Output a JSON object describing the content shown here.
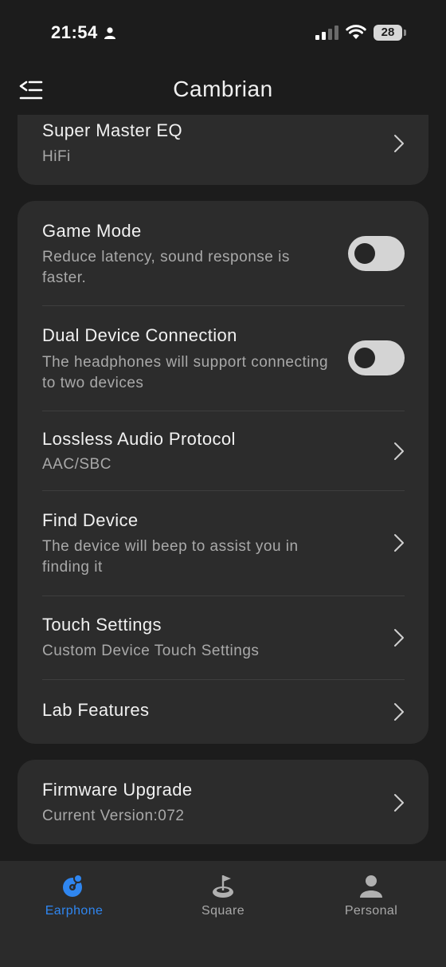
{
  "status_bar": {
    "time": "21:54",
    "battery": "28"
  },
  "header": {
    "title": "Cambrian"
  },
  "cards": {
    "eq": {
      "title": "Super Master EQ",
      "subtitle": "HiFi"
    },
    "game_mode": {
      "title": "Game Mode",
      "subtitle": "Reduce latency, sound response is faster.",
      "enabled": false
    },
    "dual_device": {
      "title": "Dual Device Connection",
      "subtitle": "The headphones will support connecting to two devices",
      "enabled": false
    },
    "lossless": {
      "title": "Lossless Audio Protocol",
      "subtitle": "AAC/SBC"
    },
    "find_device": {
      "title": "Find Device",
      "subtitle": "The device will beep to assist you in finding it"
    },
    "touch": {
      "title": "Touch Settings",
      "subtitle": "Custom Device Touch Settings"
    },
    "lab": {
      "title": "Lab Features"
    },
    "firmware": {
      "title": "Firmware Upgrade",
      "subtitle": "Current Version:072"
    }
  },
  "tabs": [
    {
      "label": "Earphone",
      "icon": "earphone-icon",
      "active": true
    },
    {
      "label": "Square",
      "icon": "square-flag-icon",
      "active": false
    },
    {
      "label": "Personal",
      "icon": "person-icon",
      "active": false
    }
  ],
  "colors": {
    "background": "#1c1c1c",
    "card": "#2c2c2c",
    "accent": "#2f86f0",
    "toggle_off": "#d4d4d4"
  }
}
